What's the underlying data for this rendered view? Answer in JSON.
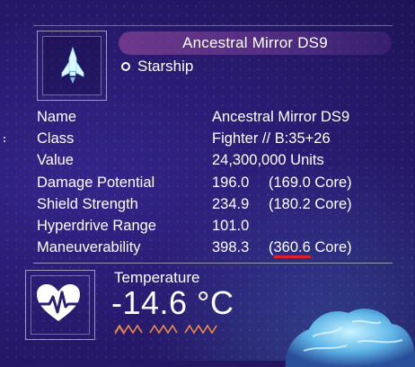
{
  "item": {
    "name": "Ancestral Mirror DS9",
    "type": "Starship",
    "icon": "starship-icon"
  },
  "stats": [
    {
      "label": "Name",
      "value": "Ancestral Mirror DS9",
      "secondary": ""
    },
    {
      "label": "Class",
      "value": "Fighter // B:35+26",
      "secondary": ""
    },
    {
      "label": "Value",
      "value": "24,300,000 Units",
      "secondary": ""
    },
    {
      "label": "Damage Potential",
      "value": "196.0",
      "secondary": "(169.0 Core)"
    },
    {
      "label": "Shield Strength",
      "value": "234.9",
      "secondary": "(180.2 Core)"
    },
    {
      "label": "Hyperdrive Range",
      "value": "101.0",
      "secondary": ""
    },
    {
      "label": "Maneuverability",
      "value": "398.3",
      "secondary_prefix": "(",
      "secondary_highlight": "360.6",
      "secondary_suffix": " Core)"
    }
  ],
  "environment": {
    "label": "Temperature",
    "value": "-14.6 °C",
    "icon": "health-heart-icon"
  },
  "colors": {
    "highlight_underline": "#e0202a",
    "accent_orange": "#f08a4b",
    "icon_cyan": "#9be7ff"
  }
}
